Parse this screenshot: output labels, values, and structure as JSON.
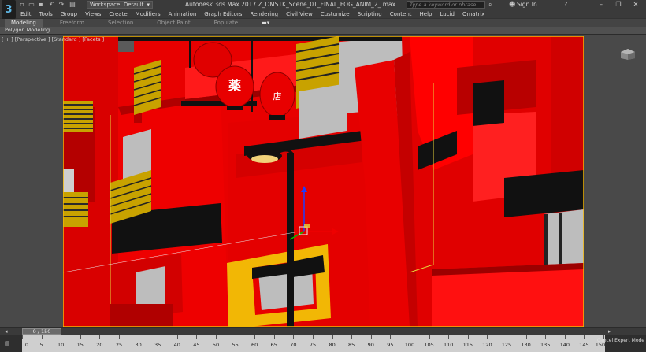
{
  "titlebar": {
    "logo": "3",
    "workspace_label": "Workspace: Default",
    "app_title": "Autodesk 3ds Max 2017     Z_DMSTK_Scene_01_FINAL_FOG_ANIM_2_.max",
    "search_placeholder": "Type a keyword or phrase",
    "signin_label": "Sign In",
    "minimize": "–",
    "maximize": "❐",
    "close": "✕"
  },
  "menubar": {
    "items": [
      "Edit",
      "Tools",
      "Group",
      "Views",
      "Create",
      "Modifiers",
      "Animation",
      "Graph Editors",
      "Rendering",
      "Civil View",
      "Customize",
      "Scripting",
      "Content",
      "Help",
      "Lucid",
      "Omatrix"
    ]
  },
  "ribbon": {
    "tabs": [
      "Modeling",
      "Freeform",
      "Selection",
      "Object Paint",
      "Populate"
    ],
    "active_tab": "Modeling",
    "panel_label": "Polygon Modeling"
  },
  "viewport": {
    "label": "[ + ] [Perspective ] [Standard ] [Facets ]",
    "lantern_glyphs": [
      "薬",
      "店"
    ]
  },
  "timeline": {
    "frame_display": "0 / 150",
    "ticks": [
      "0",
      "5",
      "10",
      "15",
      "20",
      "25",
      "30",
      "35",
      "40",
      "45",
      "50",
      "55",
      "60",
      "65",
      "70",
      "75",
      "80",
      "85",
      "90",
      "95",
      "100",
      "105",
      "110",
      "115",
      "120",
      "125",
      "130",
      "135",
      "140",
      "145",
      "150"
    ],
    "cancel_expert": "Cancel Expert Mode"
  },
  "colors": {
    "scene_red": "#e80000",
    "scene_dark_red": "#b40000",
    "gold": "#f2b705",
    "selection_yellow": "#e6d23a",
    "ui_bg": "#3a3a3a"
  }
}
